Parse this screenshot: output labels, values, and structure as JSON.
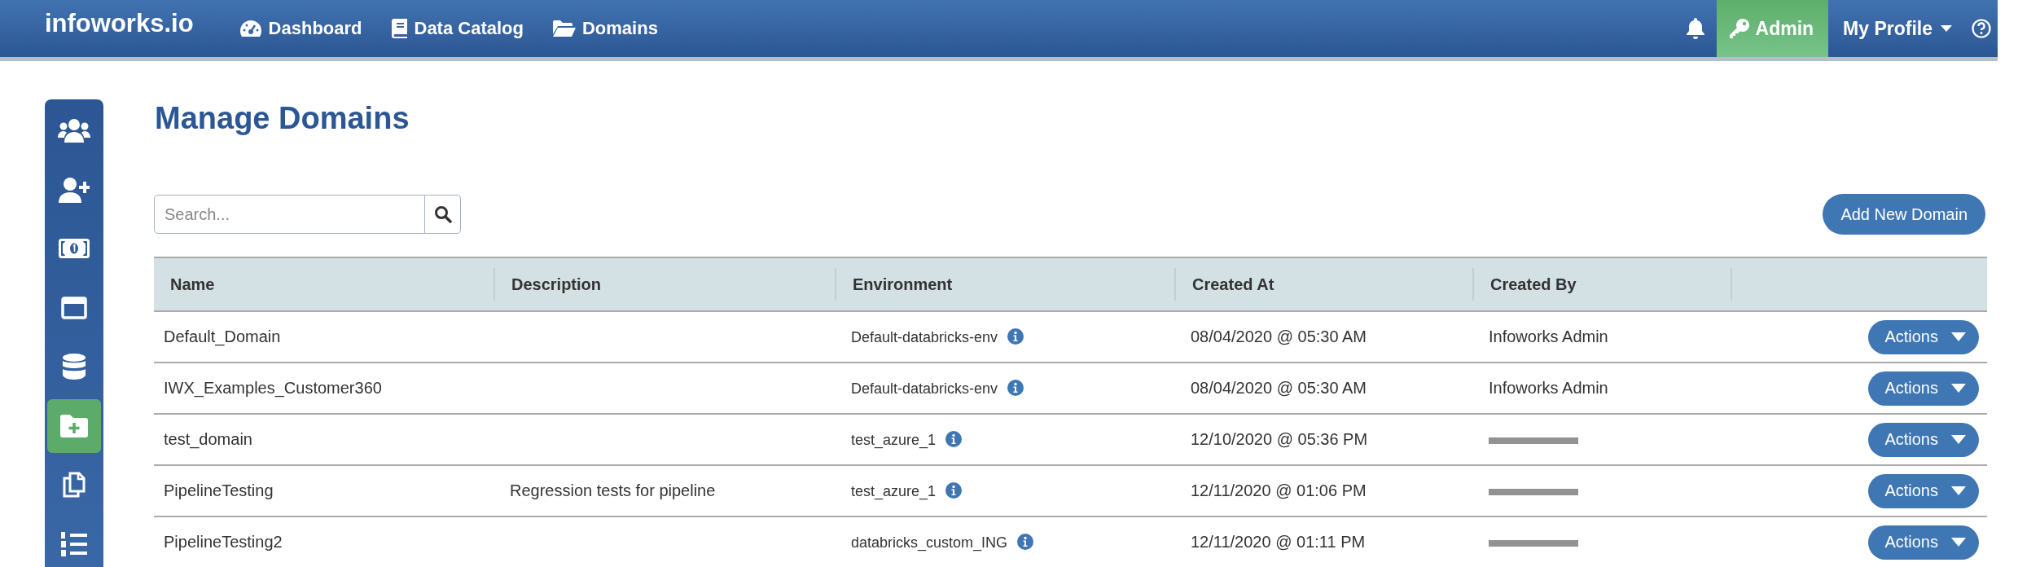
{
  "topbar": {
    "brand": "infoworks.io",
    "nav": [
      {
        "label": "Dashboard",
        "kind": "gauge"
      },
      {
        "label": "Data Catalog",
        "kind": "book"
      },
      {
        "label": "Domains",
        "kind": "folder"
      }
    ],
    "admin": {
      "label": "Admin",
      "selected": true
    },
    "profile": {
      "label": "My Profile"
    }
  },
  "sidebar": {
    "items": [
      {
        "kind": "users",
        "selected": false
      },
      {
        "kind": "user-add",
        "selected": false
      },
      {
        "kind": "money",
        "selected": false
      },
      {
        "kind": "window",
        "selected": false
      },
      {
        "kind": "database",
        "selected": false
      },
      {
        "kind": "folder-add",
        "selected": true
      },
      {
        "kind": "copy",
        "selected": false
      },
      {
        "kind": "list",
        "selected": false
      }
    ]
  },
  "page": {
    "title": "Manage Domains",
    "search": {
      "placeholder": "Search..."
    },
    "add_button": "Add New Domain"
  },
  "table": {
    "columns": [
      "Name",
      "Description",
      "Environment",
      "Created At",
      "Created By"
    ],
    "rows": [
      {
        "name": "Default_Domain",
        "environment": "Default-databricks-env",
        "created_at": "08/04/2020 @ 05:30 AM",
        "created_by": "Infoworks Admin",
        "action": "Actions"
      },
      {
        "name": "IWX_Examples_Customer360",
        "environment": "Default-databricks-env",
        "created_at": "08/04/2020 @ 05:30 AM",
        "created_by": "Infoworks Admin",
        "action": "Actions"
      },
      {
        "name": "test_domain",
        "environment": "test_azure_1",
        "created_at": "12/10/2020 @ 05:36 PM",
        "redacted": true,
        "action": "Actions"
      },
      {
        "name": "PipelineTesting",
        "description": "Regression tests for pipeline",
        "environment": "test_azure_1",
        "created_at": "12/11/2020 @ 01:06 PM",
        "redacted": true,
        "action": "Actions"
      },
      {
        "name": "PipelineTesting2",
        "environment": "databricks_custom_ING",
        "created_at": "12/11/2020 @ 01:11 PM",
        "redacted": true,
        "action": "Actions"
      }
    ]
  }
}
